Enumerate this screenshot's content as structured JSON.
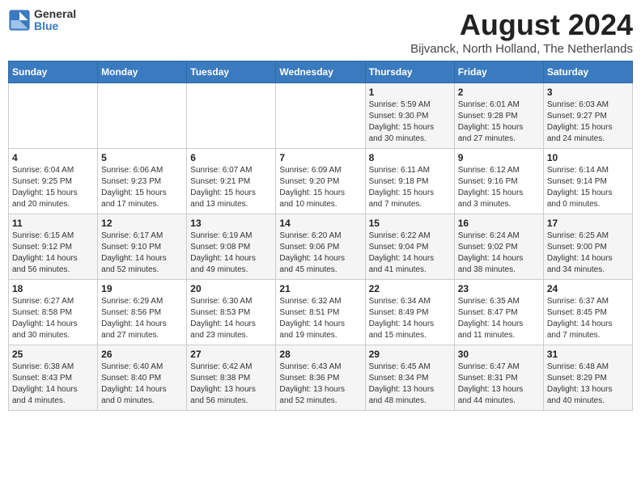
{
  "header": {
    "logo_general": "General",
    "logo_blue": "Blue",
    "title": "August 2024",
    "subtitle": "Bijvanck, North Holland, The Netherlands"
  },
  "weekdays": [
    "Sunday",
    "Monday",
    "Tuesday",
    "Wednesday",
    "Thursday",
    "Friday",
    "Saturday"
  ],
  "weeks": [
    [
      {
        "day": "",
        "info": ""
      },
      {
        "day": "",
        "info": ""
      },
      {
        "day": "",
        "info": ""
      },
      {
        "day": "",
        "info": ""
      },
      {
        "day": "1",
        "info": "Sunrise: 5:59 AM\nSunset: 9:30 PM\nDaylight: 15 hours\nand 30 minutes."
      },
      {
        "day": "2",
        "info": "Sunrise: 6:01 AM\nSunset: 9:28 PM\nDaylight: 15 hours\nand 27 minutes."
      },
      {
        "day": "3",
        "info": "Sunrise: 6:03 AM\nSunset: 9:27 PM\nDaylight: 15 hours\nand 24 minutes."
      }
    ],
    [
      {
        "day": "4",
        "info": "Sunrise: 6:04 AM\nSunset: 9:25 PM\nDaylight: 15 hours\nand 20 minutes."
      },
      {
        "day": "5",
        "info": "Sunrise: 6:06 AM\nSunset: 9:23 PM\nDaylight: 15 hours\nand 17 minutes."
      },
      {
        "day": "6",
        "info": "Sunrise: 6:07 AM\nSunset: 9:21 PM\nDaylight: 15 hours\nand 13 minutes."
      },
      {
        "day": "7",
        "info": "Sunrise: 6:09 AM\nSunset: 9:20 PM\nDaylight: 15 hours\nand 10 minutes."
      },
      {
        "day": "8",
        "info": "Sunrise: 6:11 AM\nSunset: 9:18 PM\nDaylight: 15 hours\nand 7 minutes."
      },
      {
        "day": "9",
        "info": "Sunrise: 6:12 AM\nSunset: 9:16 PM\nDaylight: 15 hours\nand 3 minutes."
      },
      {
        "day": "10",
        "info": "Sunrise: 6:14 AM\nSunset: 9:14 PM\nDaylight: 15 hours\nand 0 minutes."
      }
    ],
    [
      {
        "day": "11",
        "info": "Sunrise: 6:15 AM\nSunset: 9:12 PM\nDaylight: 14 hours\nand 56 minutes."
      },
      {
        "day": "12",
        "info": "Sunrise: 6:17 AM\nSunset: 9:10 PM\nDaylight: 14 hours\nand 52 minutes."
      },
      {
        "day": "13",
        "info": "Sunrise: 6:19 AM\nSunset: 9:08 PM\nDaylight: 14 hours\nand 49 minutes."
      },
      {
        "day": "14",
        "info": "Sunrise: 6:20 AM\nSunset: 9:06 PM\nDaylight: 14 hours\nand 45 minutes."
      },
      {
        "day": "15",
        "info": "Sunrise: 6:22 AM\nSunset: 9:04 PM\nDaylight: 14 hours\nand 41 minutes."
      },
      {
        "day": "16",
        "info": "Sunrise: 6:24 AM\nSunset: 9:02 PM\nDaylight: 14 hours\nand 38 minutes."
      },
      {
        "day": "17",
        "info": "Sunrise: 6:25 AM\nSunset: 9:00 PM\nDaylight: 14 hours\nand 34 minutes."
      }
    ],
    [
      {
        "day": "18",
        "info": "Sunrise: 6:27 AM\nSunset: 8:58 PM\nDaylight: 14 hours\nand 30 minutes."
      },
      {
        "day": "19",
        "info": "Sunrise: 6:29 AM\nSunset: 8:56 PM\nDaylight: 14 hours\nand 27 minutes."
      },
      {
        "day": "20",
        "info": "Sunrise: 6:30 AM\nSunset: 8:53 PM\nDaylight: 14 hours\nand 23 minutes."
      },
      {
        "day": "21",
        "info": "Sunrise: 6:32 AM\nSunset: 8:51 PM\nDaylight: 14 hours\nand 19 minutes."
      },
      {
        "day": "22",
        "info": "Sunrise: 6:34 AM\nSunset: 8:49 PM\nDaylight: 14 hours\nand 15 minutes."
      },
      {
        "day": "23",
        "info": "Sunrise: 6:35 AM\nSunset: 8:47 PM\nDaylight: 14 hours\nand 11 minutes."
      },
      {
        "day": "24",
        "info": "Sunrise: 6:37 AM\nSunset: 8:45 PM\nDaylight: 14 hours\nand 7 minutes."
      }
    ],
    [
      {
        "day": "25",
        "info": "Sunrise: 6:38 AM\nSunset: 8:43 PM\nDaylight: 14 hours\nand 4 minutes."
      },
      {
        "day": "26",
        "info": "Sunrise: 6:40 AM\nSunset: 8:40 PM\nDaylight: 14 hours\nand 0 minutes."
      },
      {
        "day": "27",
        "info": "Sunrise: 6:42 AM\nSunset: 8:38 PM\nDaylight: 13 hours\nand 56 minutes."
      },
      {
        "day": "28",
        "info": "Sunrise: 6:43 AM\nSunset: 8:36 PM\nDaylight: 13 hours\nand 52 minutes."
      },
      {
        "day": "29",
        "info": "Sunrise: 6:45 AM\nSunset: 8:34 PM\nDaylight: 13 hours\nand 48 minutes."
      },
      {
        "day": "30",
        "info": "Sunrise: 6:47 AM\nSunset: 8:31 PM\nDaylight: 13 hours\nand 44 minutes."
      },
      {
        "day": "31",
        "info": "Sunrise: 6:48 AM\nSunset: 8:29 PM\nDaylight: 13 hours\nand 40 minutes."
      }
    ]
  ]
}
